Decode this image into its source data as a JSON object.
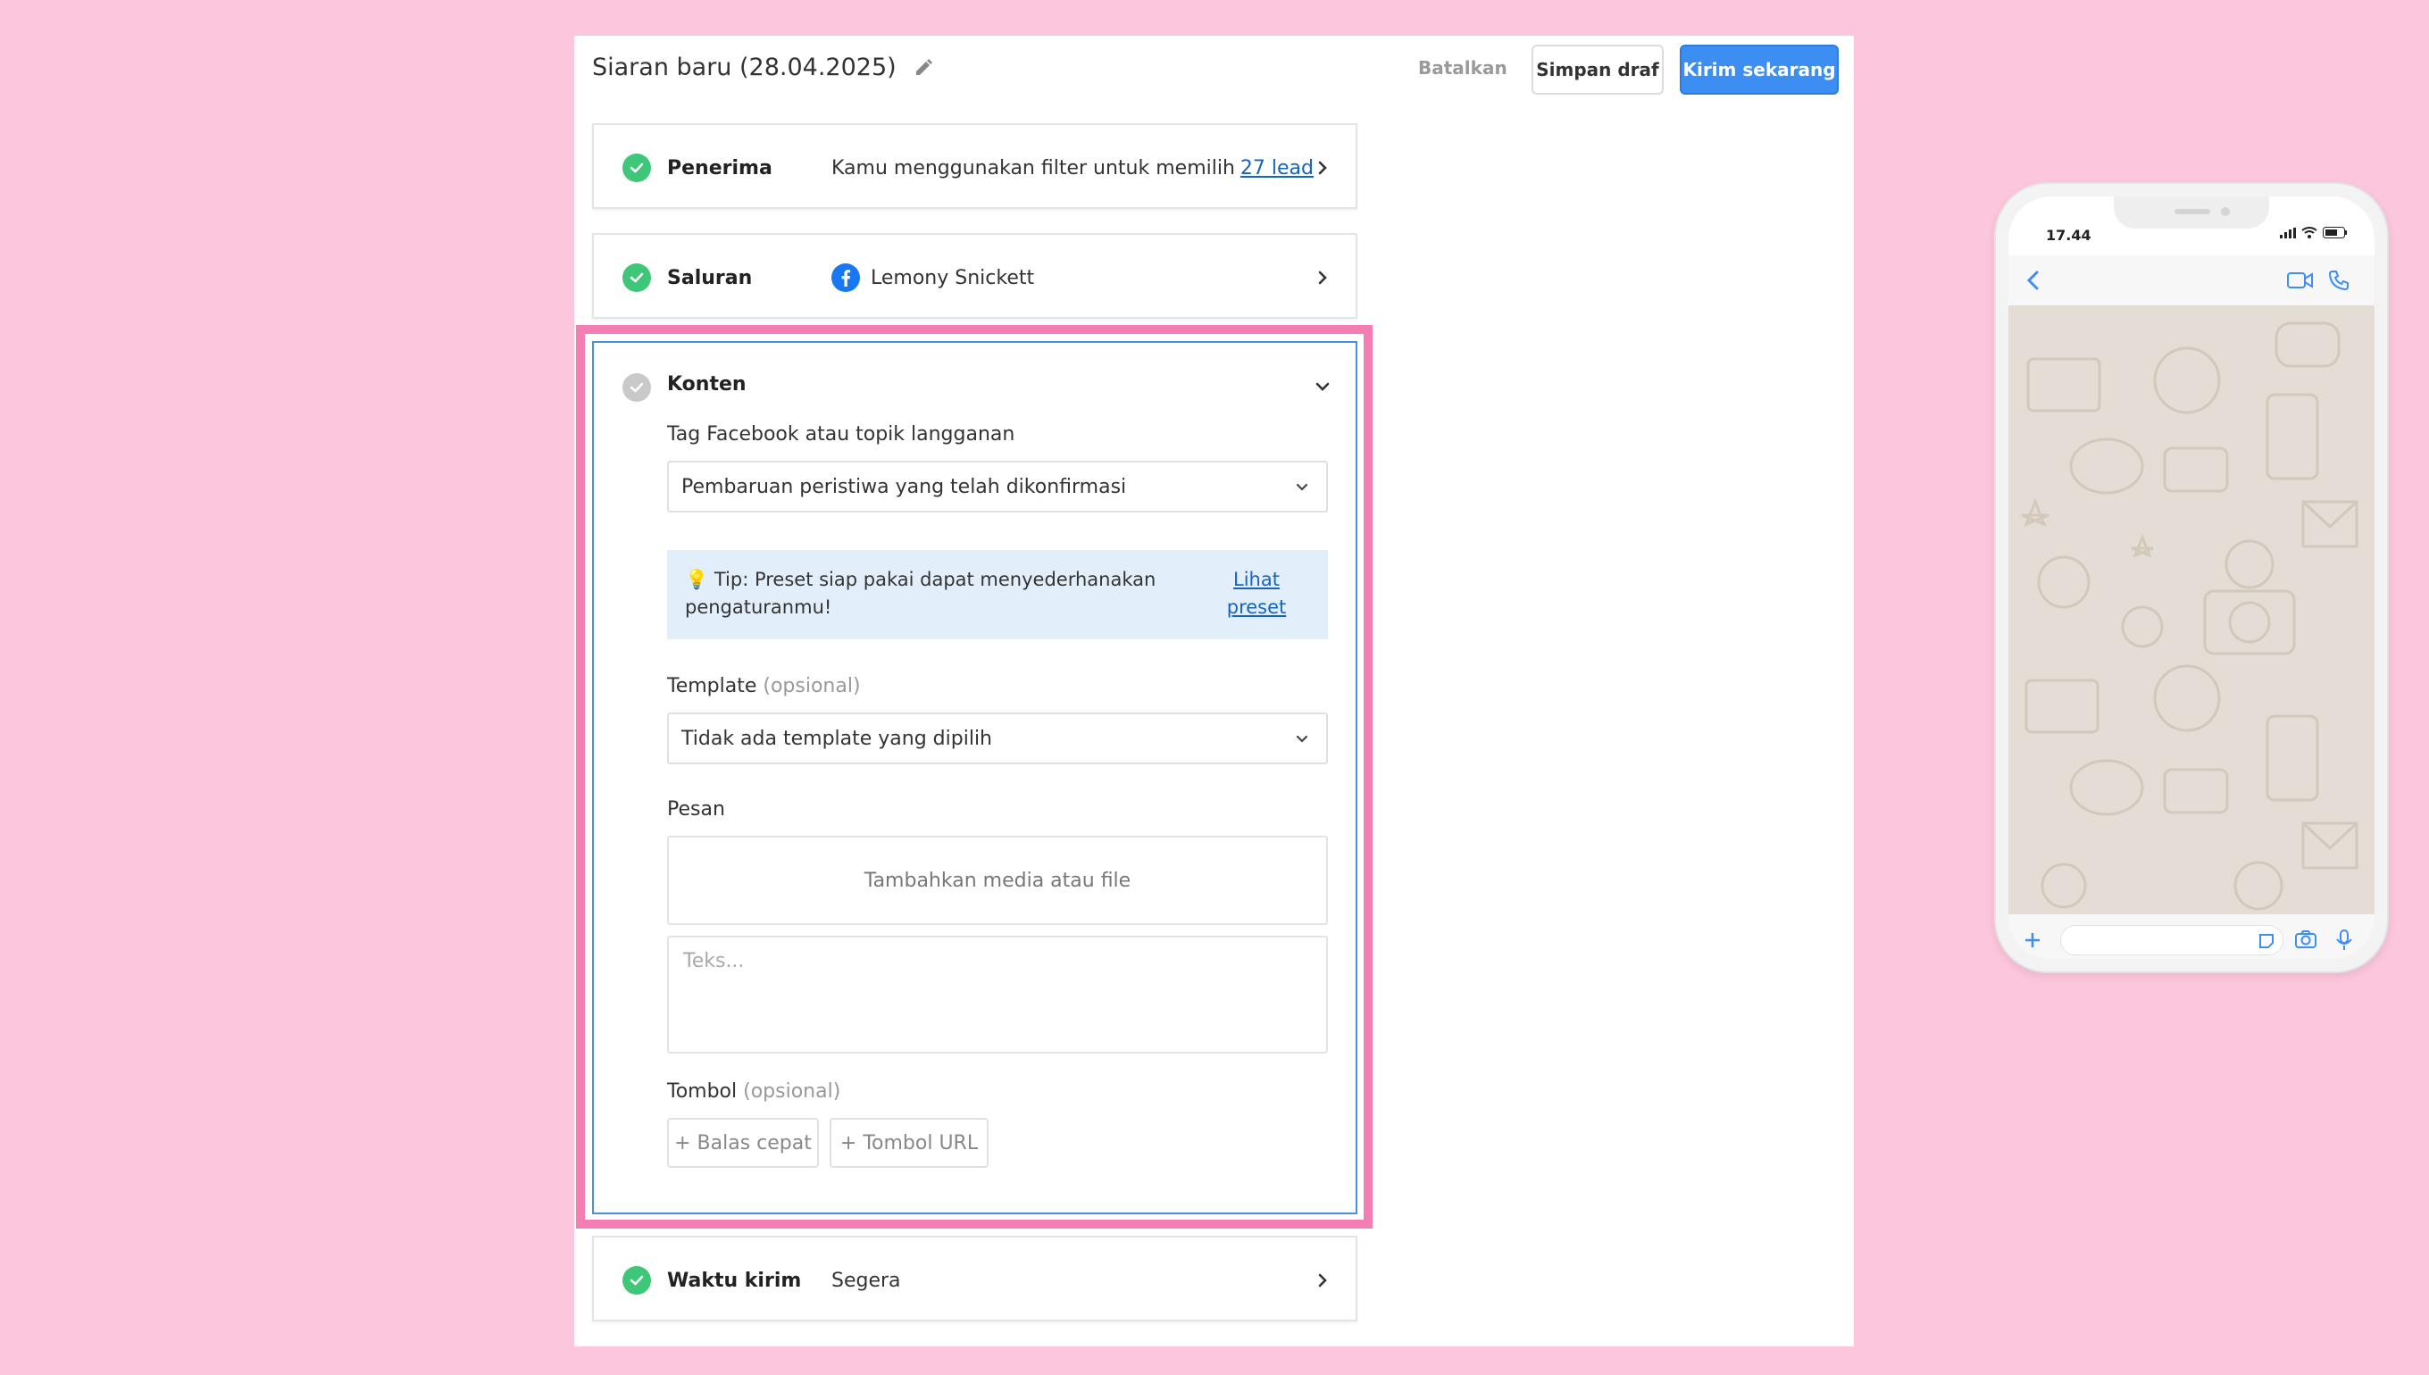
{
  "header": {
    "title": "Siaran baru (28.04.2025)",
    "cancel_label": "Batalkan",
    "draft_label": "Simpan draf",
    "send_label": "Kirim sekarang"
  },
  "steps": {
    "recipients": {
      "label": "Penerima",
      "text": "Kamu menggunakan filter untuk memilih",
      "link": "27 lead"
    },
    "channel": {
      "label": "Saluran",
      "value": "Lemony Snickett"
    },
    "content": {
      "label": "Konten",
      "tag_label": "Tag Facebook atau topik langganan",
      "tag_value": "Pembaruan peristiwa yang telah dikonfirmasi",
      "tip_text": "Tip: Preset siap pakai dapat menyederhanakan pengaturanmu!",
      "tip_link": "Lihat preset",
      "template_label": "Template",
      "template_optional": "(opsional)",
      "template_value": "Tidak ada template yang dipilih",
      "message_label": "Pesan",
      "media_placeholder": "Tambahkan media atau file",
      "text_placeholder": "Teks...",
      "buttons_label": "Tombol",
      "buttons_optional": "(opsional)",
      "quick_reply_label": "+ Balas cepat",
      "url_button_label": "+ Tombol URL"
    },
    "send_time": {
      "label": "Waktu kirim",
      "value": "Segera"
    }
  },
  "phone_preview": {
    "time": "17.44"
  },
  "colors": {
    "accent": "#3d8ef2",
    "success": "#3ec679",
    "highlight": "#f47eb3",
    "background": "#fcc6dc"
  }
}
